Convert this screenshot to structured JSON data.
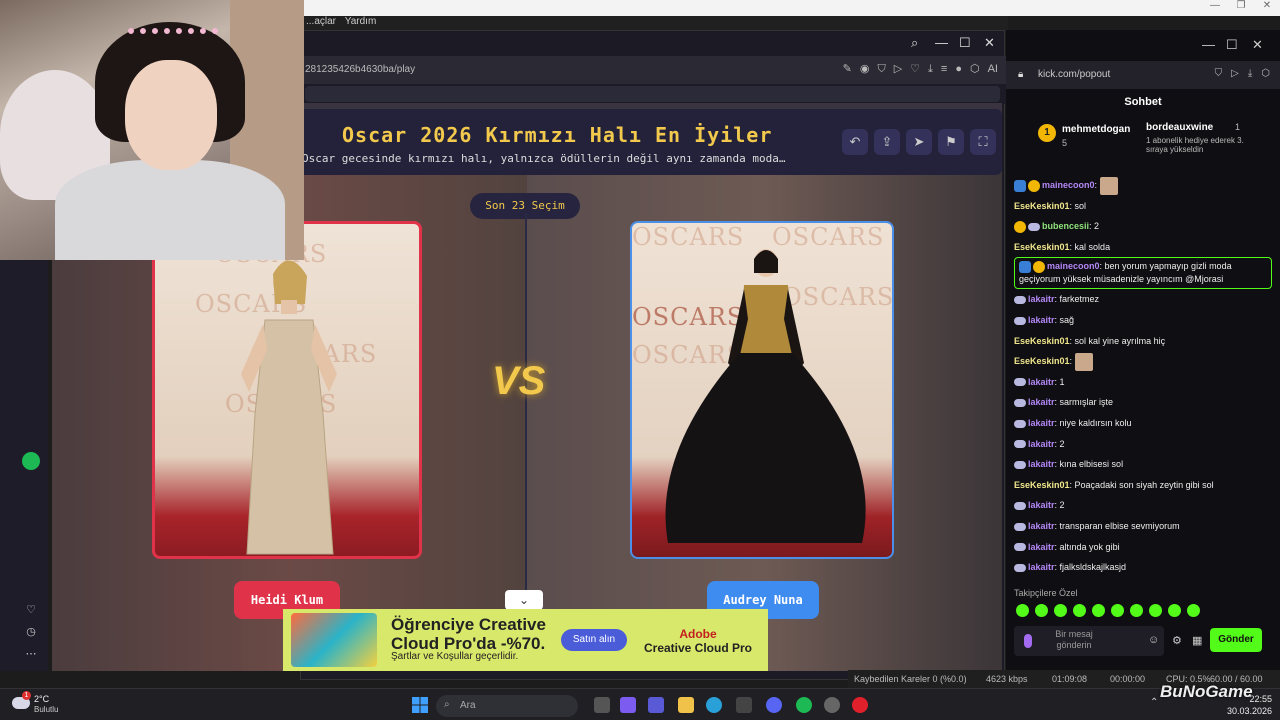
{
  "os": {
    "weather": {
      "temp": "2°C",
      "desc": "Bulutlu",
      "badge": "1"
    },
    "search_placeholder": "Ara",
    "clock_time": "22:55",
    "clock_date": "30.03.2026"
  },
  "menubar": {
    "items": [
      "...açlar",
      "Yardım"
    ]
  },
  "browser": {
    "url": "281235426b4630ba/play"
  },
  "game": {
    "title": "Oscar 2026 Kırmızı Halı En İyiler",
    "subtitle": "Oscar gecesinde kırmızı halı, yalnızca ödüllerin değil aynı zamanda moda…",
    "round_label": "Son 23 Seçim",
    "vs_label": "VS",
    "left_name": "Heidi Klum",
    "right_name": "Audrey Nuna",
    "oscars_word": "OSCARS"
  },
  "ad": {
    "title": "Öğrenciye Creative Cloud Pro'da -%70.",
    "subtitle": "Şartlar ve Koşullar geçerlidir.",
    "button": "Satın alın",
    "brand_top": "Adobe",
    "brand_bottom": "Creative Cloud Pro"
  },
  "kick": {
    "url": "kick.com/popout",
    "chat_header": "Sohbet",
    "gifter": {
      "rank": "1",
      "name": "mehmetdogan",
      "count": "5"
    },
    "gift2": {
      "name": "bordeauxwine",
      "count": "1",
      "message": "1 abonelik hediye ederek 3. sıraya yükseldin"
    },
    "messages": [
      {
        "user": "mainecoon0",
        "text": ":",
        "color": "purple",
        "emote": true,
        "badges": "bg"
      },
      {
        "user": "EseKeskin01",
        "text": ": sol",
        "color": "yellow",
        "badges": ""
      },
      {
        "user": "bubencesii",
        "text": ": 2",
        "color": "green",
        "badges": "gw"
      },
      {
        "user": "EseKeskin01",
        "text": ": kal solda",
        "color": "yellow",
        "badges": ""
      },
      {
        "user": "mainecoon0",
        "text": ": ben yorum yapmayıp gizli moda geçiyorum yüksek müsadenizle yayıncım @Mjorasi",
        "color": "purple",
        "badges": "bg",
        "highlight": true
      },
      {
        "user": "lakaitr",
        "text": ": farketmez",
        "color": "purple",
        "badges": "w"
      },
      {
        "user": "lakaitr",
        "text": ": sağ",
        "color": "purple",
        "badges": "w"
      },
      {
        "user": "EseKeskin01",
        "text": ": sol kal yine ayrılma hiç",
        "color": "yellow",
        "badges": ""
      },
      {
        "user": "EseKeskin01",
        "text": ":",
        "color": "yellow",
        "emote": true,
        "badges": ""
      },
      {
        "user": "lakaitr",
        "text": ": 1",
        "color": "purple",
        "badges": "w"
      },
      {
        "user": "lakaitr",
        "text": ": sarmışlar işte",
        "color": "purple",
        "badges": "w"
      },
      {
        "user": "lakaitr",
        "text": ": niye kaldırsın kolu",
        "color": "purple",
        "badges": "w"
      },
      {
        "user": "lakaitr",
        "text": ": 2",
        "color": "purple",
        "badges": "w"
      },
      {
        "user": "lakaitr",
        "text": ": kına elbisesi sol",
        "color": "purple",
        "badges": "w"
      },
      {
        "user": "EseKeskin01",
        "text": ": Poaçadaki son siyah zeytin gibi sol",
        "color": "yellow",
        "badges": ""
      },
      {
        "user": "lakaitr",
        "text": ": 2",
        "color": "purple",
        "badges": "w"
      },
      {
        "user": "lakaitr",
        "text": ": transparan elbise sevmiyorum",
        "color": "purple",
        "badges": "w"
      },
      {
        "user": "lakaitr",
        "text": ": altında yok gibi",
        "color": "purple",
        "badges": "w"
      },
      {
        "user": "lakaitr",
        "text": ": fjalksldskajlkasjd",
        "color": "purple",
        "badges": "w"
      }
    ],
    "emote_label": "Takipçilere Özel",
    "input_placeholder": "Bir mesaj gönderin",
    "send_label": "Gönder"
  },
  "obs": {
    "dropped": "Kaybedilen Kareler 0 (%0.0)",
    "bitrate": "4623 kbps",
    "live_time": "01:09:08",
    "rec_time": "00:00:00",
    "cpu": "CPU: 0.5%",
    "fps": "60.00 / 60.00 FPS"
  },
  "watermark": "BuNoGame"
}
